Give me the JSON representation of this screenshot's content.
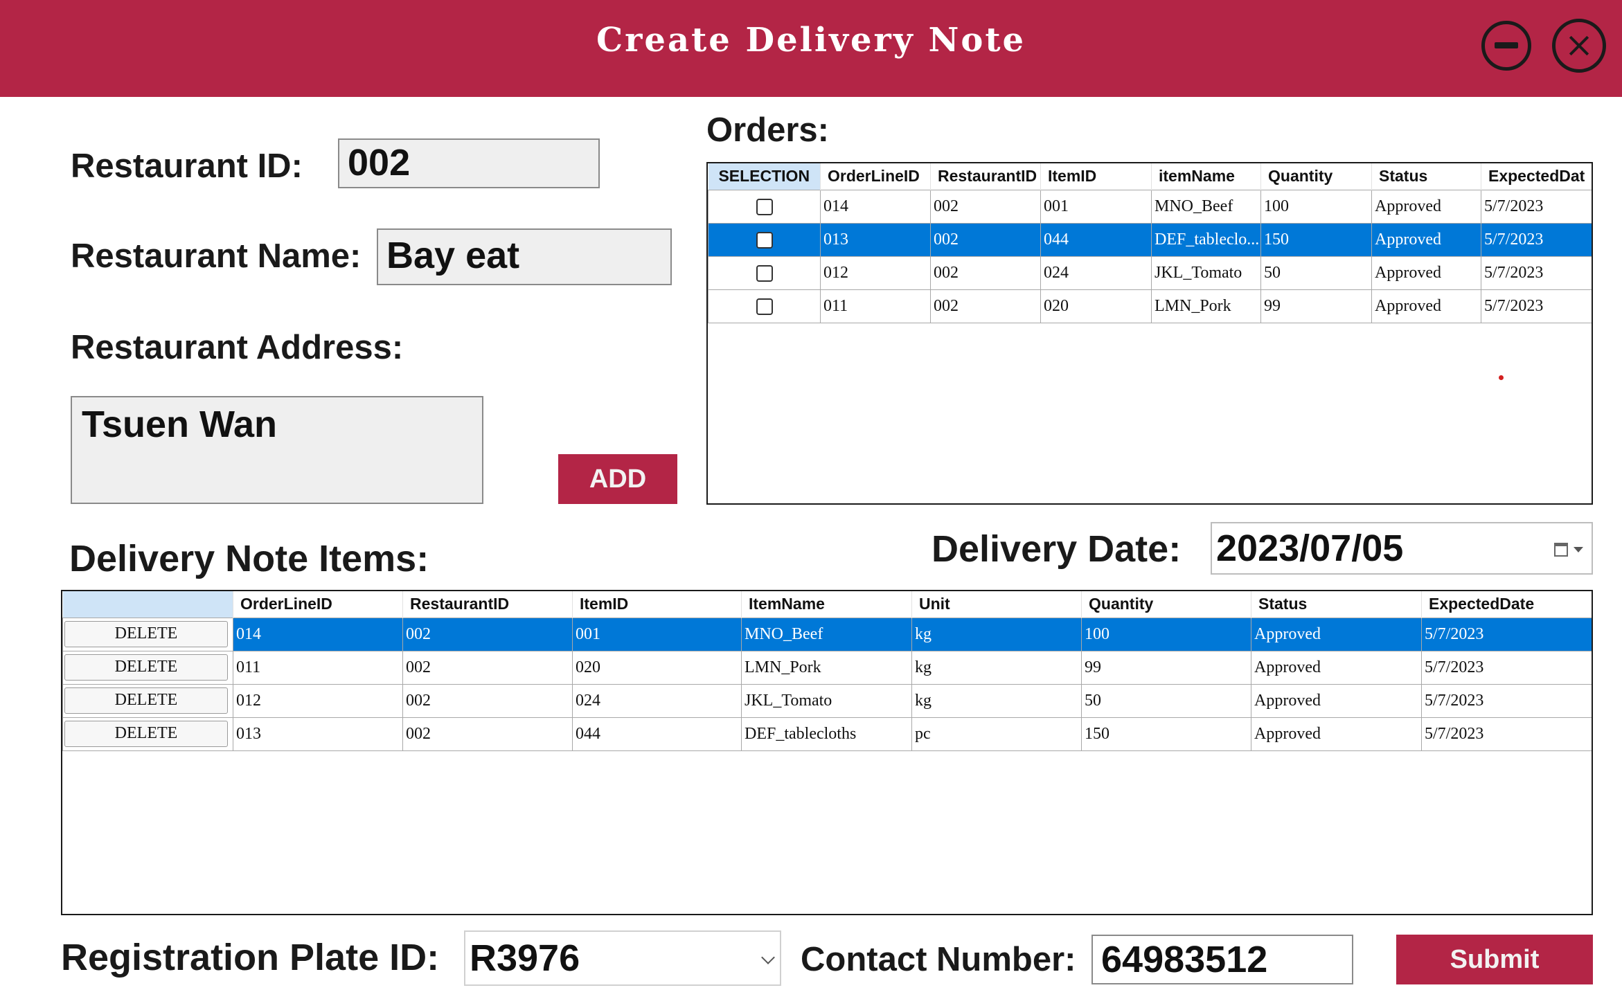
{
  "window": {
    "title": "Create Delivery Note",
    "accent_color": "#b32546",
    "minimize_icon": "minus-circle-icon",
    "close_icon": "x-circle-icon"
  },
  "restaurant": {
    "id_label": "Restaurant ID:",
    "id_value": "002",
    "name_label": "Restaurant Name:",
    "name_value": "Bay eat",
    "address_label": "Restaurant Address:",
    "address_value": "Tsuen Wan"
  },
  "add_button_label": "ADD",
  "orders": {
    "heading": "Orders:",
    "columns": [
      "SELECTION",
      "OrderLineID",
      "RestaurantID",
      "ItemID",
      "itemName",
      "Quantity",
      "Status",
      "ExpectedDat"
    ],
    "rows": [
      {
        "checked": false,
        "selected": false,
        "cells": [
          "014",
          "002",
          "001",
          "MNO_Beef",
          "100",
          "Approved",
          "5/7/2023"
        ]
      },
      {
        "checked": false,
        "selected": true,
        "cells": [
          "013",
          "002",
          "044",
          "DEF_tableclo...",
          "150",
          "Approved",
          "5/7/2023"
        ]
      },
      {
        "checked": false,
        "selected": false,
        "cells": [
          "012",
          "002",
          "024",
          "JKL_Tomato",
          "50",
          "Approved",
          "5/7/2023"
        ]
      },
      {
        "checked": false,
        "selected": false,
        "cells": [
          "011",
          "002",
          "020",
          "LMN_Pork",
          "99",
          "Approved",
          "5/7/2023"
        ]
      }
    ]
  },
  "delivery_items": {
    "heading": "Delivery Note Items:",
    "columns": [
      "",
      "OrderLineID",
      "RestaurantID",
      "ItemID",
      "ItemName",
      "Unit",
      "Quantity",
      "Status",
      "ExpectedDate"
    ],
    "delete_label": "DELETE",
    "rows": [
      {
        "selected": true,
        "cells": [
          "014",
          "002",
          "001",
          "MNO_Beef",
          "kg",
          "100",
          "Approved",
          "5/7/2023"
        ]
      },
      {
        "selected": false,
        "cells": [
          "011",
          "002",
          "020",
          "LMN_Pork",
          "kg",
          "99",
          "Approved",
          "5/7/2023"
        ]
      },
      {
        "selected": false,
        "cells": [
          "012",
          "002",
          "024",
          "JKL_Tomato",
          "kg",
          "50",
          "Approved",
          "5/7/2023"
        ]
      },
      {
        "selected": false,
        "cells": [
          "013",
          "002",
          "044",
          "DEF_tablecloths",
          "pc",
          "150",
          "Approved",
          "5/7/2023"
        ]
      }
    ]
  },
  "delivery_date": {
    "label": "Delivery Date:",
    "value": "2023/07/05"
  },
  "registration": {
    "label": "Registration Plate ID:",
    "value": "R3976"
  },
  "contact": {
    "label": "Contact Number:",
    "value": "64983512"
  },
  "submit_label": "Submit",
  "selection_color": "#0078d7"
}
